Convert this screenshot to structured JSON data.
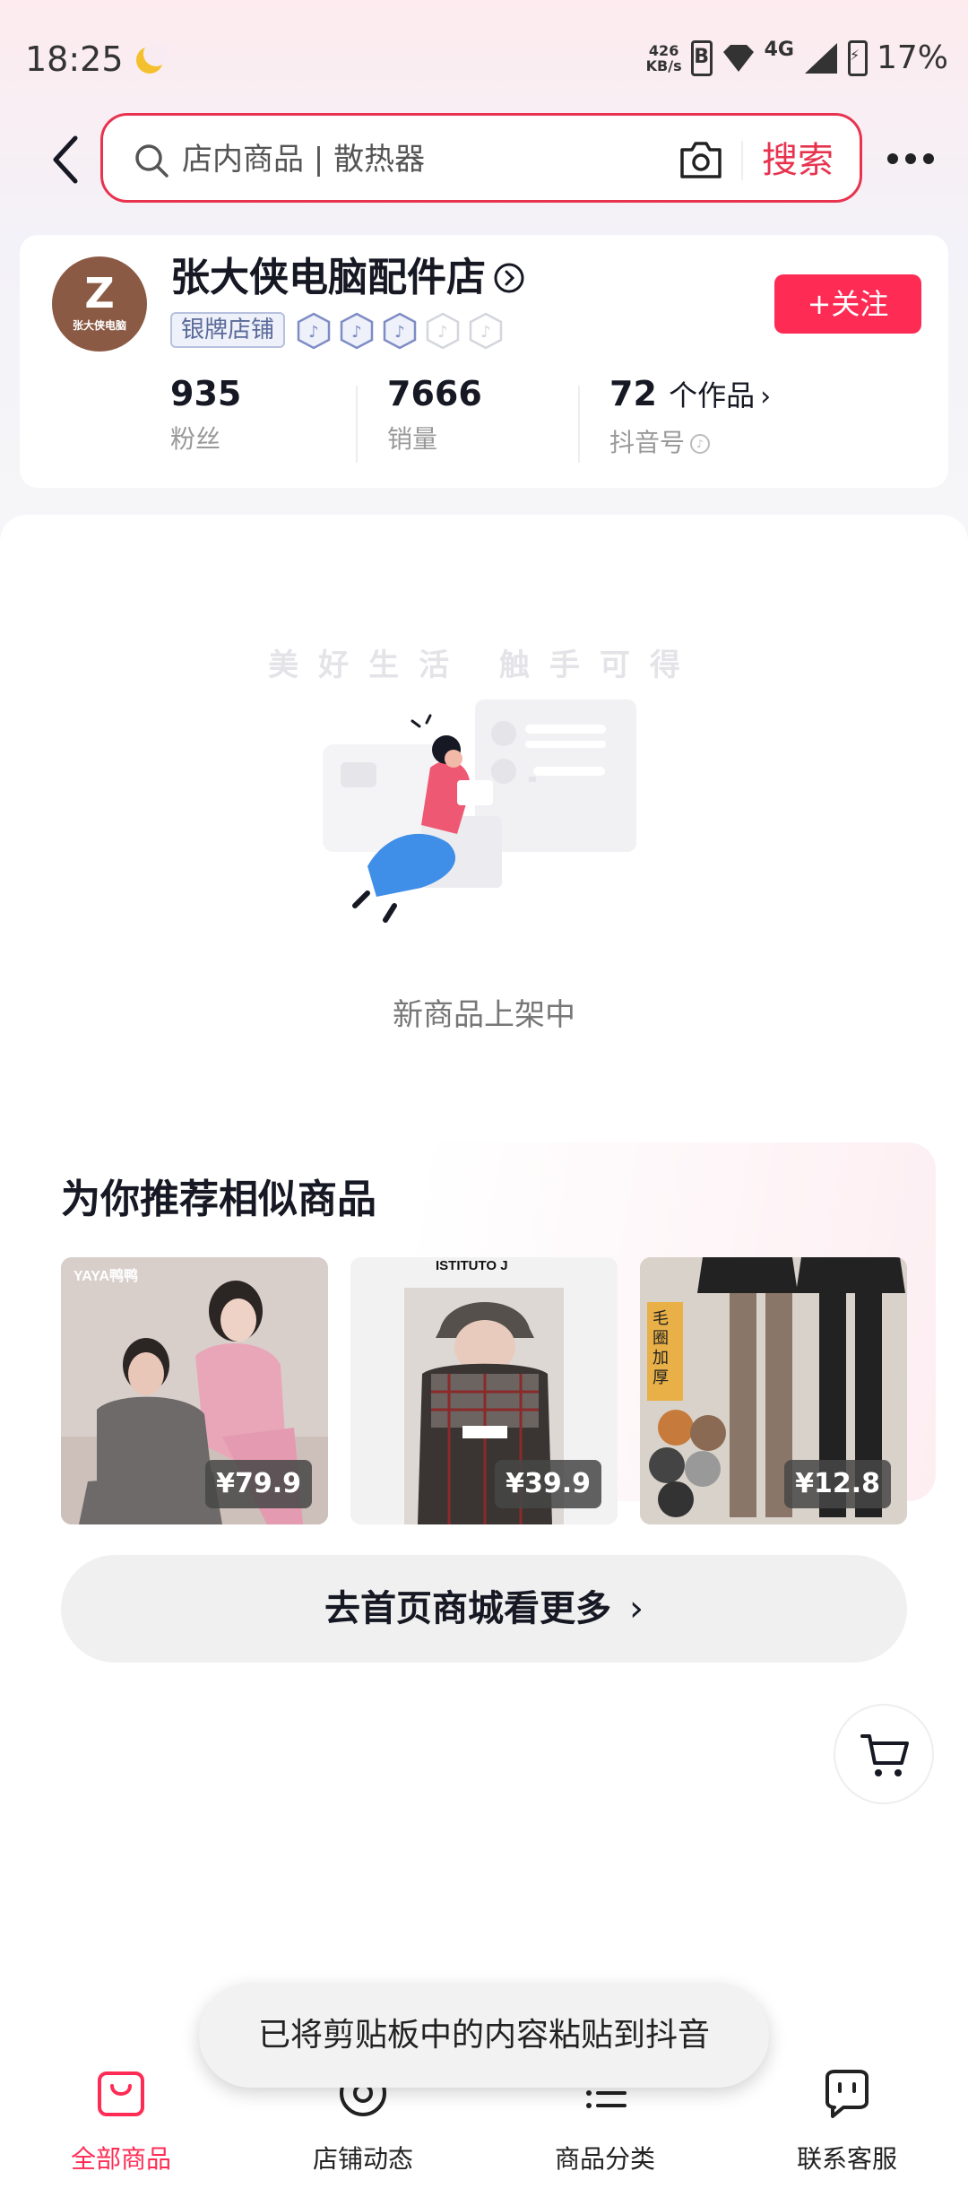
{
  "status_bar": {
    "time": "18:25",
    "net_speed_value": "426",
    "net_speed_unit": "KB/s",
    "network": "4G",
    "battery": "17%"
  },
  "search": {
    "placeholder": "店内商品 | 散热器",
    "button_label": "搜索"
  },
  "store": {
    "avatar_letter": "Z",
    "avatar_text": "张大侠电脑",
    "name": "张大侠电脑配件店",
    "badge": "银牌店铺",
    "follow_label": "+关注",
    "stats": [
      {
        "value": "935",
        "label": "粉丝"
      },
      {
        "value": "7666",
        "label": "销量"
      },
      {
        "value": "72",
        "unit": "个作品",
        "label": "抖音号"
      }
    ]
  },
  "empty_state": {
    "slogan": "美好生活 触手可得",
    "message": "新商品上架中"
  },
  "recommend": {
    "title": "为你推荐相似商品",
    "products": [
      {
        "brand": "YAYA鸭鸭",
        "price": "¥79.9"
      },
      {
        "brand": "ISTITUTO J",
        "price": "¥39.9"
      },
      {
        "brand": "毛圈加厚",
        "price": "¥12.8"
      }
    ],
    "more_label": "去首页商城看更多"
  },
  "toast": "已将剪贴板中的内容粘贴到抖音",
  "bottom_nav": [
    {
      "label": "全部商品",
      "active": true
    },
    {
      "label": "店铺动态",
      "active": false
    },
    {
      "label": "商品分类",
      "active": false
    },
    {
      "label": "联系客服",
      "active": false
    }
  ],
  "colors": {
    "accent": "#fe2c55",
    "search_border": "#e8334f",
    "avatar_bg": "#8b5a44"
  }
}
